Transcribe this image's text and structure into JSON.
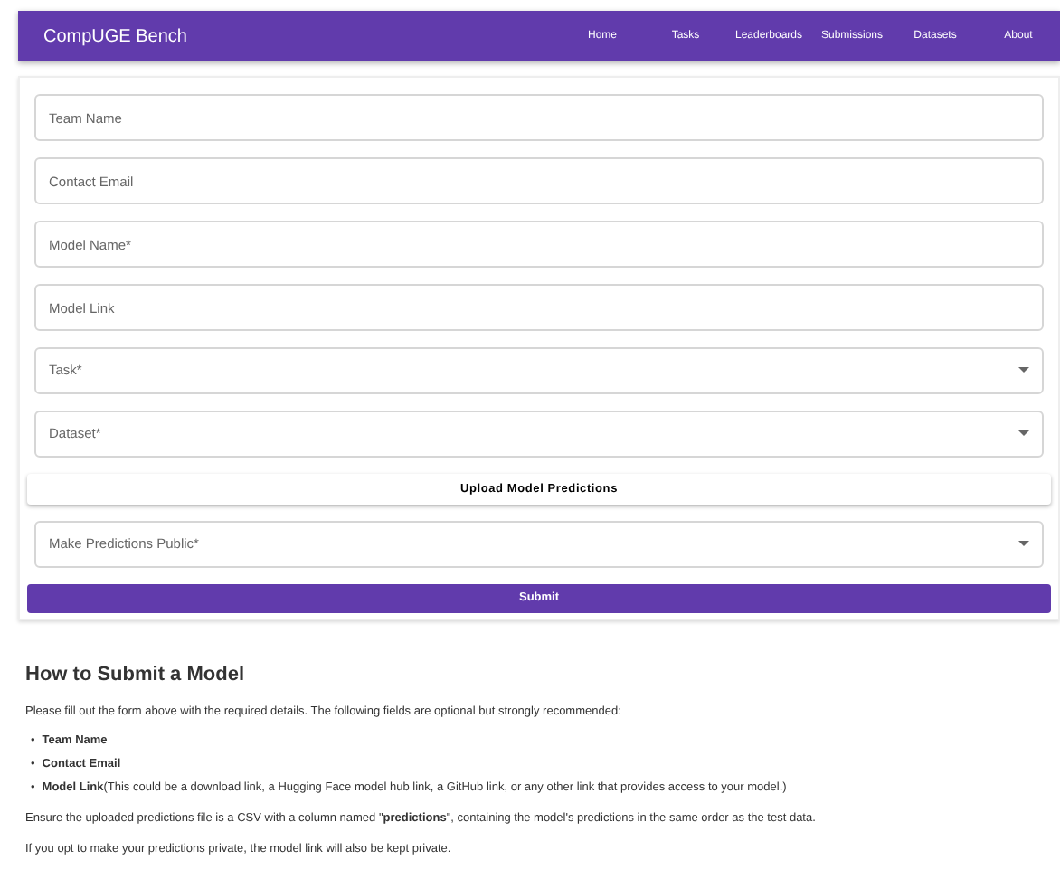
{
  "navbar": {
    "brand": "CompUGE Bench",
    "links": [
      "Home",
      "Tasks",
      "Leaderboards",
      "Submissions",
      "Datasets",
      "About"
    ]
  },
  "form": {
    "fields": [
      {
        "kind": "text",
        "placeholder": "Team Name"
      },
      {
        "kind": "text",
        "placeholder": "Contact Email"
      },
      {
        "kind": "text",
        "placeholder": "Model Name*"
      },
      {
        "kind": "text",
        "placeholder": "Model Link"
      },
      {
        "kind": "select",
        "placeholder": "Task*"
      },
      {
        "kind": "select",
        "placeholder": "Dataset*"
      },
      {
        "kind": "upload",
        "label": "Upload Model Predictions"
      },
      {
        "kind": "select",
        "placeholder": "Make Predictions Public*"
      }
    ],
    "submit": "Submit"
  },
  "instructions": {
    "title": "How to Submit a Model",
    "intro": "Please fill out the form above with the required details. The following fields are optional but strongly recommended:",
    "items": [
      {
        "marker": "•",
        "text": "**Team Name**"
      },
      {
        "marker": "•",
        "text": "**Contact Email**"
      },
      {
        "marker": "•",
        "text": "**Model Link**(This could be a download link, a Hugging Face model hub link, a GitHub link, or any other link that provides access to your model.)"
      }
    ],
    "paragraphs": [
      "Ensure the uploaded predictions file is a CSV with a column named \"**predictions**\", containing the model's predictions in the same order as the test data.",
      "If you opt to make your predictions private, the model link will also be kept private."
    ]
  }
}
